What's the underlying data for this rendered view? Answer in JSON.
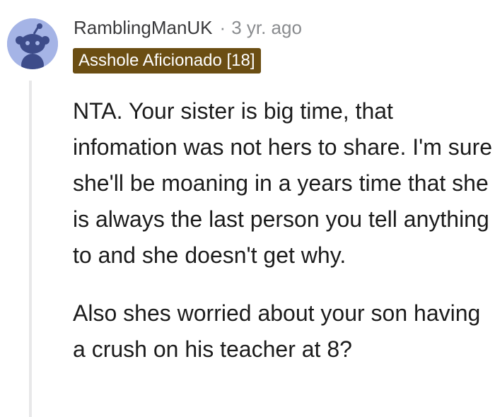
{
  "comment": {
    "author": "RamblingManUK",
    "separator": "·",
    "timestamp": "3 yr. ago",
    "flair": "Asshole Aficionado [18]",
    "avatar_icon": "snoo-avatar-icon",
    "paragraphs": [
      "NTA. Your sister is big time, that infomation was not hers to share. I'm sure she'll be moaning in a years time that she is always the last person you tell anything to and she doesn't get why.",
      "Also shes worried about your son having a crush on his teacher at 8?"
    ]
  },
  "colors": {
    "avatar_bg": "#a5b4e6",
    "avatar_figure": "#3d4c8a",
    "flair_bg": "#6b4e13",
    "flair_text": "#ffffff",
    "thread_line": "#e8e8e9"
  }
}
